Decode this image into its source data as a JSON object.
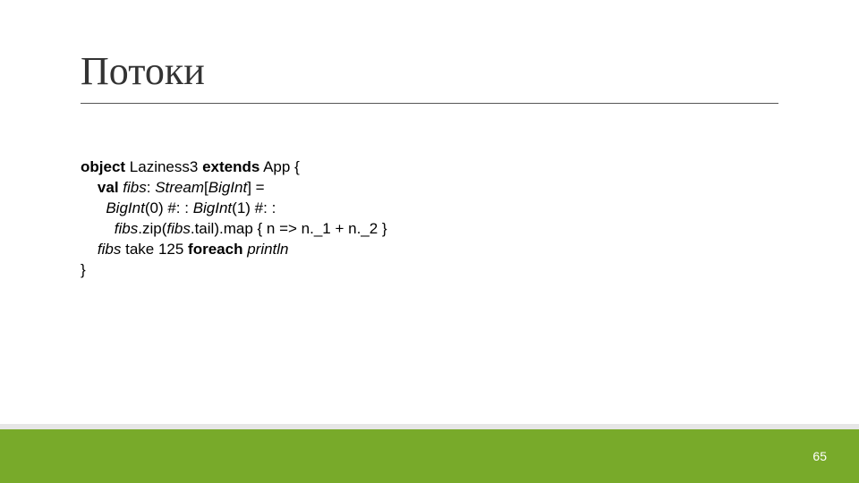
{
  "title": "Потоки",
  "code": {
    "l1": {
      "kw1": "object",
      "rest1": " Laziness3 ",
      "kw2": "extends",
      "rest2": " App {"
    },
    "l2": {
      "indent": "    ",
      "kw": "val",
      "sp": " ",
      "var": "fibs",
      "colon": ": ",
      "ty1": "Stream",
      "br1": "[",
      "ty2": "BigInt",
      "br2": "] ="
    },
    "l3": {
      "indent": "      ",
      "ty1": "BigInt",
      "args1": "(0) #: : ",
      "ty2": "BigInt",
      "args2": "(1) #: :"
    },
    "l4": {
      "indent": "        ",
      "v1": "fibs",
      "d1": ".zip(",
      "v2": "fibs",
      "d2": ".tail).map { n => n._1 + n._2 }"
    },
    "l5": {
      "indent": "    ",
      "v": "fibs",
      "sp1": " take 125 ",
      "kw": "foreach",
      "sp2": " ",
      "fn": "println"
    },
    "l6": "}"
  },
  "page_number": "65"
}
